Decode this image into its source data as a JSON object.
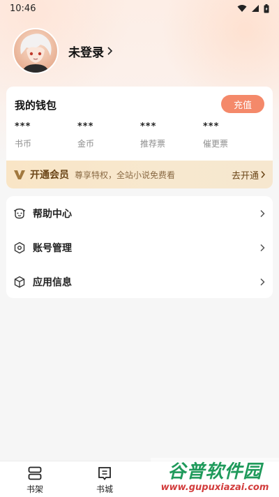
{
  "status_bar": {
    "time": "10:46"
  },
  "profile": {
    "name": "未登录"
  },
  "wallet": {
    "title": "我的钱包",
    "recharge_label": "充值",
    "stats": [
      {
        "value": "***",
        "label": "书币"
      },
      {
        "value": "***",
        "label": "金币"
      },
      {
        "value": "***",
        "label": "推荐票"
      },
      {
        "value": "***",
        "label": "催更票"
      }
    ]
  },
  "vip": {
    "title": "开通会员",
    "subtitle": "尊享特权，全站小说免费看",
    "cta": "去开通"
  },
  "menu": [
    {
      "label": "帮助中心",
      "icon": "help-face-icon"
    },
    {
      "label": "账号管理",
      "icon": "hexagon-settings-icon"
    },
    {
      "label": "应用信息",
      "icon": "cube-info-icon"
    }
  ],
  "tabbar": [
    {
      "label": "书架",
      "icon": "bookshelf-icon"
    },
    {
      "label": "书城",
      "icon": "bookstore-icon"
    }
  ],
  "watermark": {
    "big": "谷普软件园",
    "small": "www.gupuxiazai.com"
  }
}
